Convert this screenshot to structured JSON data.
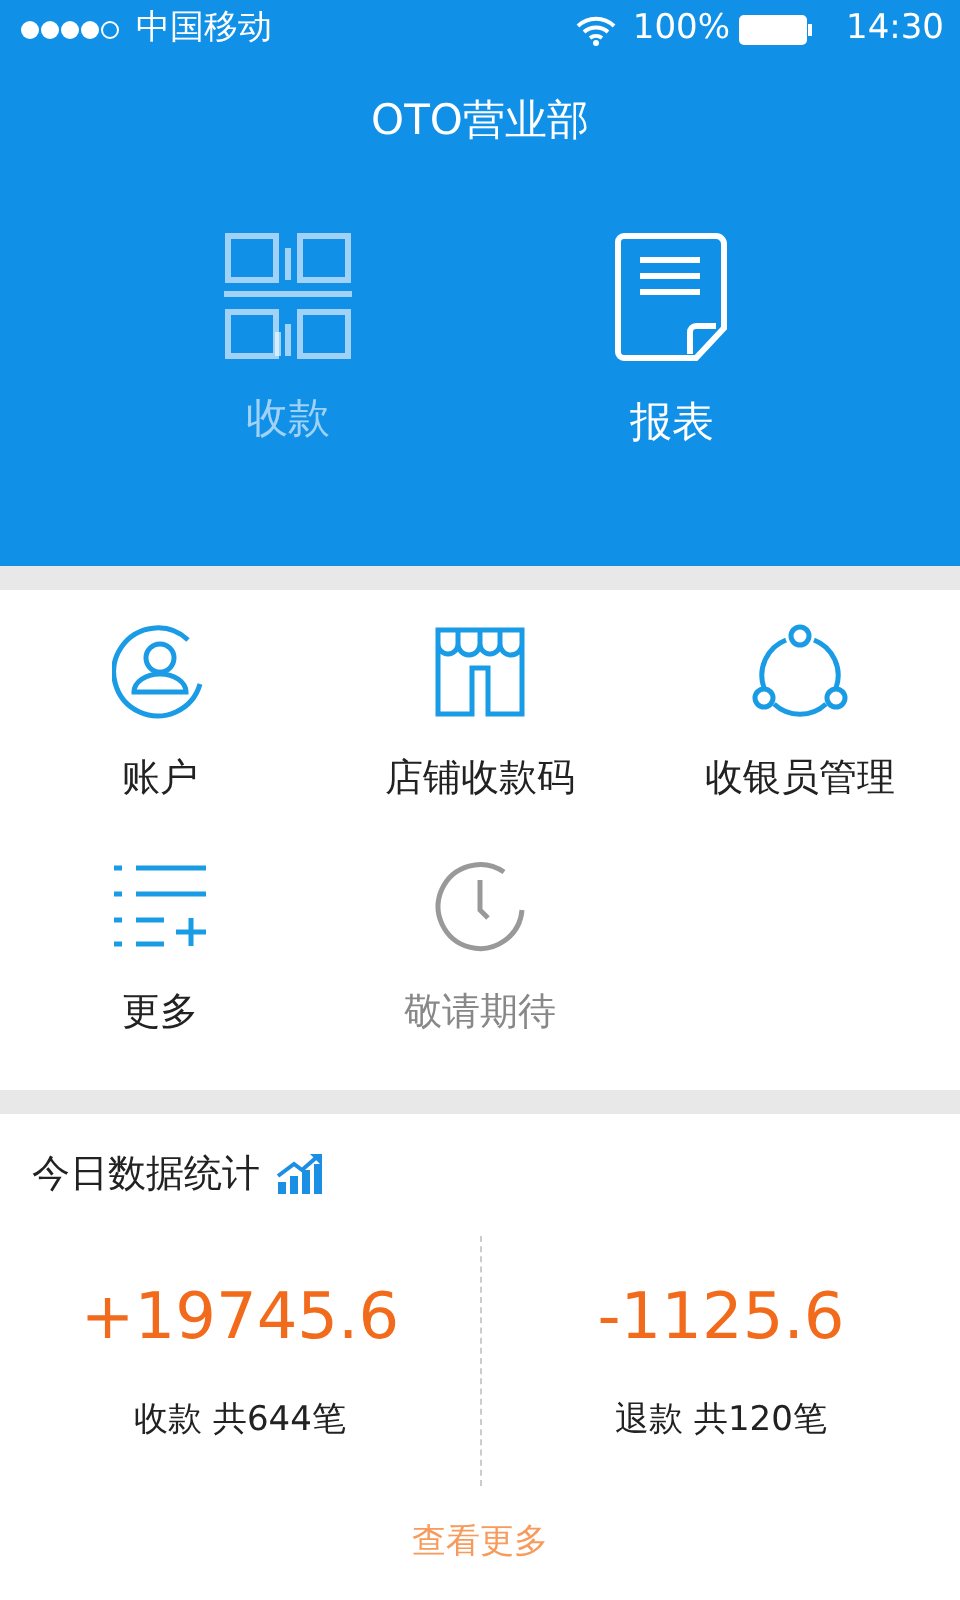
{
  "status_bar": {
    "carrier": "中国移动",
    "battery": "100%",
    "time": "14:30"
  },
  "title": "OTO营业部",
  "top_actions": [
    {
      "label": "收款",
      "selected": false
    },
    {
      "label": "报表",
      "selected": true
    }
  ],
  "grid": [
    {
      "label": "账户",
      "disabled": false
    },
    {
      "label": "店铺收款码",
      "disabled": false
    },
    {
      "label": "收银员管理",
      "disabled": false
    },
    {
      "label": "更多",
      "disabled": false
    },
    {
      "label": "敬请期待",
      "disabled": true
    }
  ],
  "stats": {
    "title": "今日数据统计",
    "items": [
      {
        "amount": "+19745.6",
        "caption": "收款 共644笔"
      },
      {
        "amount": "-1125.6",
        "caption": "退款 共120笔"
      }
    ],
    "more": "查看更多"
  }
}
